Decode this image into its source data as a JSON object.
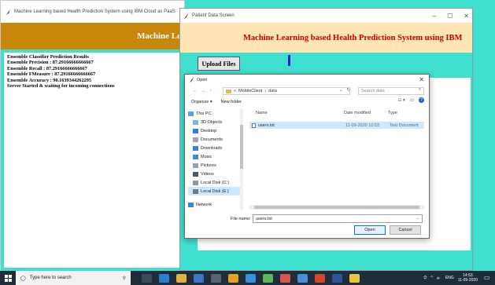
{
  "back_window": {
    "title": "Machine Learning based Health Prediction System using IBM Cloud as PaaS",
    "banner": "Machine Le",
    "log_lines": [
      "Ensemble Classifier Prediction Results",
      "Ensemble  Precision : 87.29166666666667",
      "Ensemble  Recall  : 87.29166666666667",
      "Ensemble  FMeasure : 87.29166666666667",
      "Ensemble  Accuracy : 90.1639344262295",
      "Server Started & waiting for incoming connections"
    ]
  },
  "front_window": {
    "title": "Patient Data Screen",
    "banner": "Machine Learning based Health Prediction System using IBM",
    "upload_label": "Upload Files",
    "controls": [
      "–",
      "☐",
      "✕"
    ]
  },
  "dialog": {
    "title": "Open",
    "path": [
      "«",
      "MobileClient",
      "›",
      "data"
    ],
    "search_placeholder": "Search data",
    "organize_label": "Organize ▾",
    "new_folder_label": "New folder",
    "nav_items": [
      "This PC",
      "3D Objects",
      "Desktop",
      "Documents",
      "Downloads",
      "Music",
      "Pictures",
      "Videos",
      "Local Disk (C:)",
      "Local Disk (E:)",
      "Network"
    ],
    "columns": [
      "Name",
      "Date modified",
      "Type"
    ],
    "files": [
      {
        "name": "users.txt",
        "date": "11-09-2020 10:53",
        "type": "Text Document"
      }
    ],
    "file_name_label": "File name:",
    "file_name_value": "users.txt",
    "open_label": "Open",
    "cancel_label": "Cancel"
  },
  "taskbar": {
    "search_placeholder": "Type here to search",
    "time": "14:53",
    "date": "11-09-2020",
    "tray_text": "ENG"
  },
  "colors": {
    "desktop": "#40e0d0",
    "back_banner": "#c8860b",
    "front_banner": "#ffe4b5",
    "front_banner_text": "#cc0000"
  }
}
